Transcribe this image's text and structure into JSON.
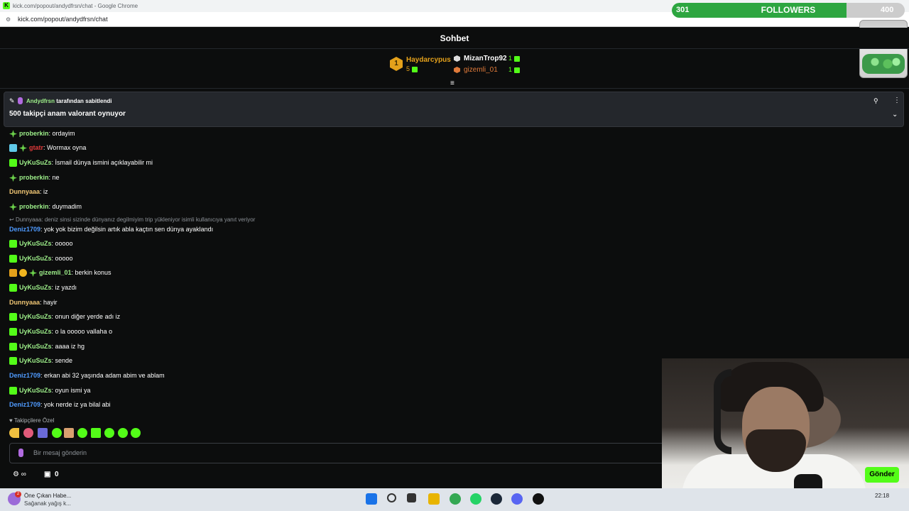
{
  "window": {
    "title": "kick.com/popout/andydfrsn/chat - Google Chrome",
    "url": "kick.com/popout/andydfrsn/chat"
  },
  "goal": {
    "current": "301",
    "label": "FOLLOWERS",
    "target": "400",
    "progress": 0.75
  },
  "chat_header": {
    "title": "Sohbet"
  },
  "leaderboard": {
    "first": {
      "rank": "1",
      "name": "Haydarcypus",
      "count": "5"
    },
    "second": {
      "name": "MizanTrop92",
      "count": "1"
    },
    "third": {
      "name": "gizemli_01",
      "count": "1"
    }
  },
  "pinned": {
    "pinned_by": "Andydfrsn",
    "pinned_suffix": "tarafından sabitlendi",
    "text": "500 takipçi anam valorant oynuyor"
  },
  "messages": [
    {
      "user": "proberkin",
      "color": "#9ef08a",
      "text": ": ordayim"
    },
    {
      "user": "gtatr",
      "color": "#e23a3a",
      "text": ": Wormax oyna"
    },
    {
      "user": "UyKuSuZs",
      "color": "#9ef08a",
      "text": ": İsmail dünya ismini açıklayabilir mi"
    },
    {
      "user": "proberkin",
      "color": "#9ef08a",
      "text": ": ne"
    },
    {
      "user": "Dunnyaaa",
      "color": "#f0c674",
      "text": ": iz"
    },
    {
      "user": "proberkin",
      "color": "#9ef08a",
      "text": ": duymadim"
    },
    {
      "user": "Deniz1709",
      "color": "#4f9bff",
      "text": ": yok yok bizim değilsin artık abla kaçtın sen dünya ayaklandı"
    },
    {
      "user": "UyKuSuZs",
      "color": "#9ef08a",
      "text": ": ooooo"
    },
    {
      "user": "UyKuSuZs",
      "color": "#9ef08a",
      "text": ": ooooo"
    },
    {
      "user": "gizemli_01",
      "color": "#9ef08a",
      "text": ": berkin konus"
    },
    {
      "user": "UyKuSuZs",
      "color": "#9ef08a",
      "text": ": iz yazdı"
    },
    {
      "user": "Dunnyaaa",
      "color": "#f0c674",
      "text": ": hayir"
    },
    {
      "user": "UyKuSuZs",
      "color": "#9ef08a",
      "text": ": onun diğer yerde adı iz"
    },
    {
      "user": "UyKuSuZs",
      "color": "#9ef08a",
      "text": ": o la ooooo vallaha o"
    },
    {
      "user": "UyKuSuZs",
      "color": "#9ef08a",
      "text": ": aaaa iz hg"
    },
    {
      "user": "UyKuSuZs",
      "color": "#9ef08a",
      "text": ": sende"
    },
    {
      "user": "Deniz1709",
      "color": "#4f9bff",
      "text": ": erkan abi 32 yaşında adam abim ve ablam"
    },
    {
      "user": "UyKuSuZs",
      "color": "#9ef08a",
      "text": ": oyun ismi ya"
    },
    {
      "user": "Deniz1709",
      "color": "#4f9bff",
      "text": ": yok nerde iz ya bilal abi"
    }
  ],
  "reply_context": "Dunnyaaa: deniz sinsi sizinde dünyanız degilmiyim trip yükleniyor isimli kullanıcıya yanıt veriyor",
  "emotes_section": {
    "label": "Takipçilere Özel"
  },
  "input": {
    "placeholder": "Bir mesaj gönderin"
  },
  "footer": {
    "points": "0",
    "send_label": "Gönder"
  },
  "taskbar": {
    "news_title": "Öne Çıkan Habe...",
    "news_sub": "Sağanak yağış k...",
    "news_badge": "2",
    "time": "22:18"
  }
}
